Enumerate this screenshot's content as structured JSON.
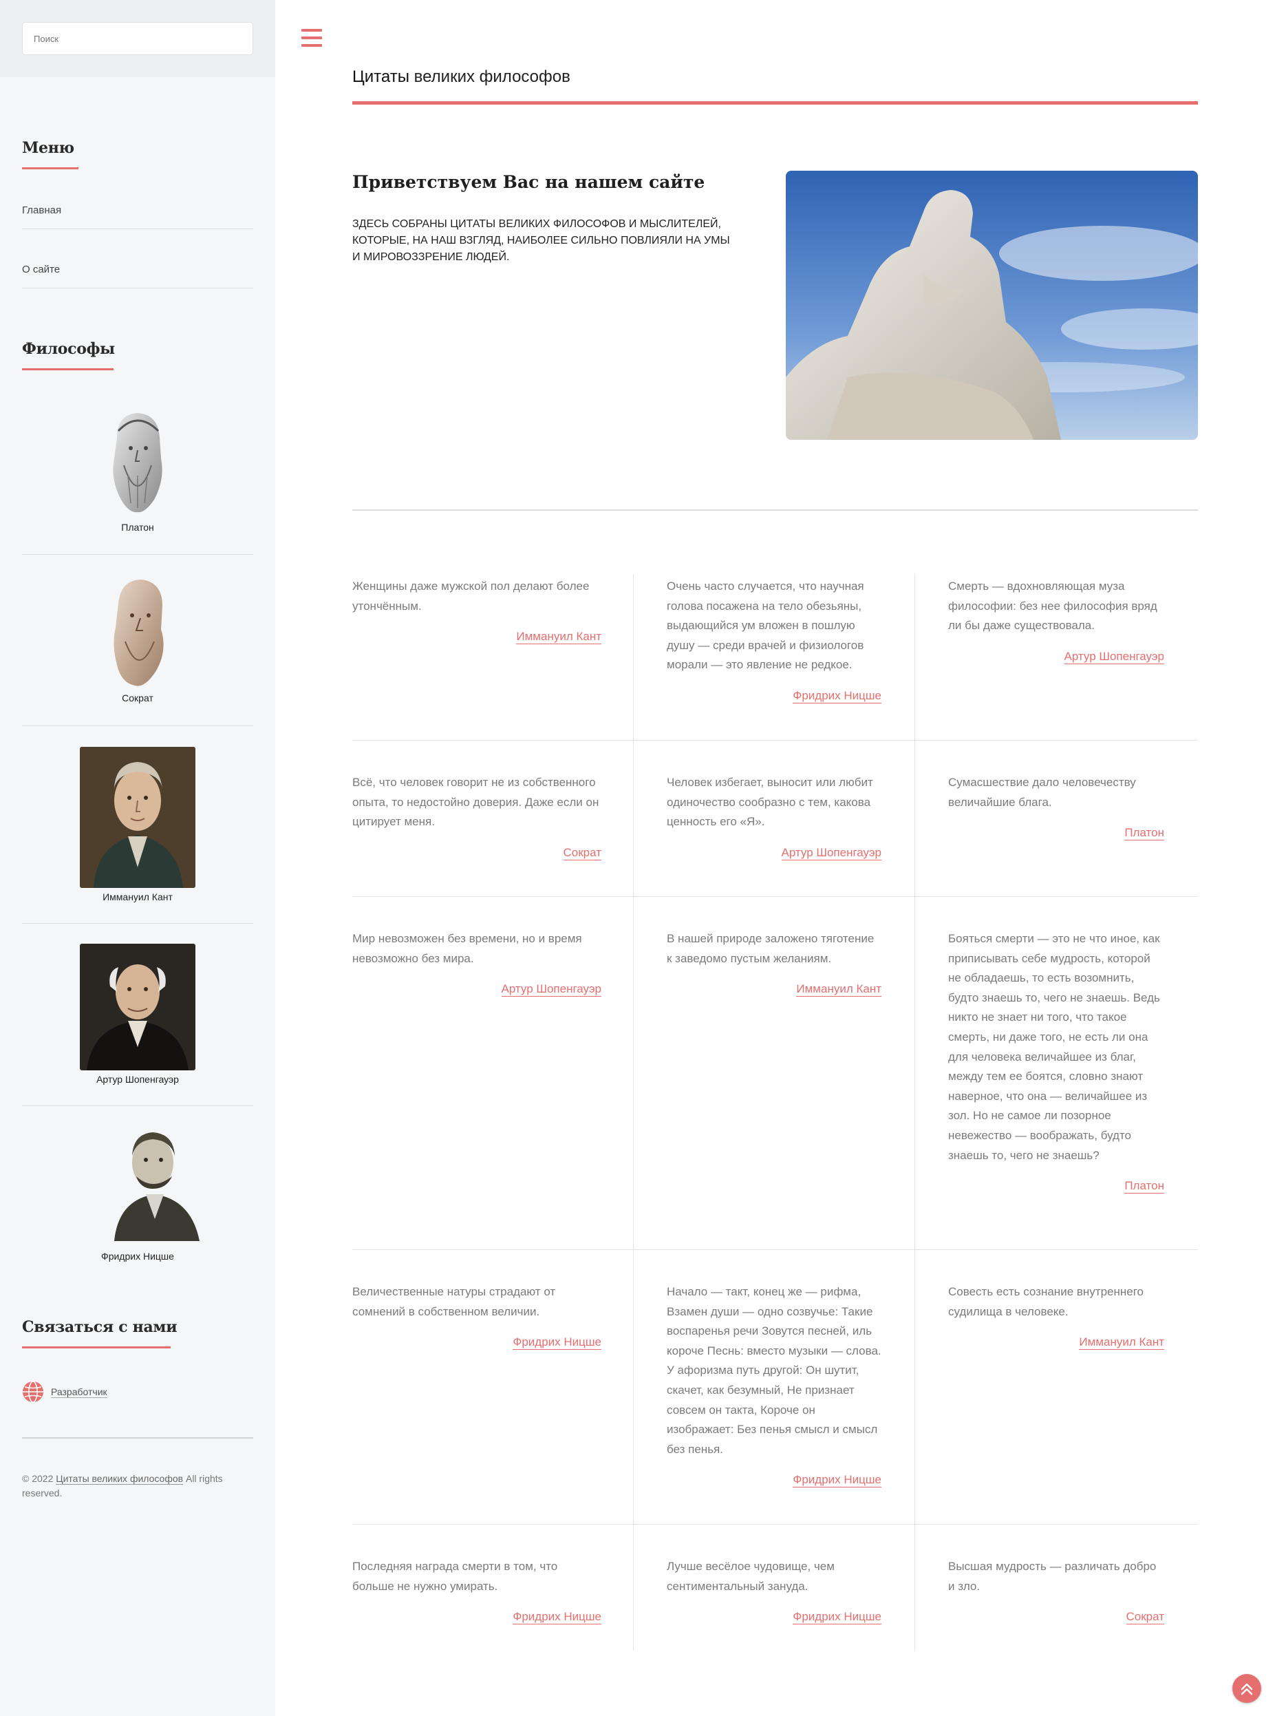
{
  "search": {
    "placeholder": "Поиск"
  },
  "menu": {
    "heading": "Меню",
    "items": [
      {
        "label": "Главная"
      },
      {
        "label": "О сайте"
      }
    ]
  },
  "philosophers": {
    "heading": "Философы",
    "items": [
      {
        "name": "Платон"
      },
      {
        "name": "Сократ"
      },
      {
        "name": "Иммануил Кант"
      },
      {
        "name": "Артур Шопенгауэр"
      },
      {
        "name": "Фридрих Ницше"
      }
    ]
  },
  "contact": {
    "heading": "Связаться с нами",
    "developer_label": "Разработчик",
    "icon": "globe-icon"
  },
  "footer": {
    "copyright_prefix": "© 2022",
    "site_link": "Цитаты великих философов",
    "rights": "All rights reserved."
  },
  "header": {
    "title_bold": "Цитаты",
    "title_rest": "великих философов"
  },
  "welcome": {
    "heading": "Приветствуем Вас на нашем сайте",
    "text": "Здесь собраны цитаты великих философов и мыслителей, которые, на наш взгляд, наиболее сильно повлияли на умы и мировоззрение людей."
  },
  "quotes": [
    {
      "text": "Женщины даже мужской пол делают более утончённым.",
      "author": "Иммануил Кант"
    },
    {
      "text": "Очень часто случается, что научная голова посажена на тело обезьяны, выдающийся ум вложен в пошлую душу — среди врачей и физиологов морали — это явление не редкое.",
      "author": "Фридрих Ницше"
    },
    {
      "text": "Смерть — вдохновляющая муза философии: без нее философия вряд ли бы даже существовала.",
      "author": "Артур Шопенгауэр"
    },
    {
      "text": "Всё, что человек говорит не из собственного опыта, то недостойно доверия. Даже если он цитирует меня.",
      "author": "Сократ"
    },
    {
      "text": "Человек избегает, выносит или любит одиночество сообразно с тем, какова ценность его «Я».",
      "author": "Артур Шопенгауэр"
    },
    {
      "text": "Сумасшествие дало человечеству величайшие блага.",
      "author": "Платон"
    },
    {
      "text": "Мир невозможен без времени, но и время невозможно без мира.",
      "author": "Артур Шопенгауэр"
    },
    {
      "text": "В нашей природе заложено тяготение к заведомо пустым желаниям.",
      "author": "Иммануил Кант"
    },
    {
      "text": "Бояться смерти — это не что иное, как приписывать себе мудрость, которой не обладаешь, то есть возомнить, будто знаешь то, чего не знаешь. Ведь никто не знает ни того, что такое смерть, ни даже того, не есть ли она для человека величайшее из благ, между тем ее боятся, словно знают наверное, что она — величайшее из зол. Но не самое ли позорное невежество — воображать, будто знаешь то, чего не знаешь?",
      "author": "Платон"
    },
    {
      "text": "Величественные натуры страдают от сомнений в собственном величии.",
      "author": "Фридрих Ницше"
    },
    {
      "text": "Начало — такт, конец же — рифма, Взамен души — одно созвучье: Такие воспаренья речи Зовутся песней, иль короче Песнь: вместо музыки — слова. У афоризма путь другой: Он шутит, скачет, как безумный, Не признает совсем он такта, Короче он изображает: Без пенья смысл и смысл без пенья.",
      "author": "Фридрих Ницше"
    },
    {
      "text": "Совесть есть сознание внутреннего судилища в человеке.",
      "author": "Иммануил Кант"
    },
    {
      "text": "Последняя награда смерти в том, что больше не нужно умирать.",
      "author": "Фридрих Ницше"
    },
    {
      "text": "Лучше весёлое чудовище, чем сентиментальный зануда.",
      "author": "Фридрих Ницше"
    },
    {
      "text": "Высшая мудрость — различать добро и зло.",
      "author": "Сократ"
    }
  ],
  "colors": {
    "accent": "#e56f6f",
    "sidebar_bg": "#f5f6f7",
    "text_muted": "#7b7b7b"
  }
}
